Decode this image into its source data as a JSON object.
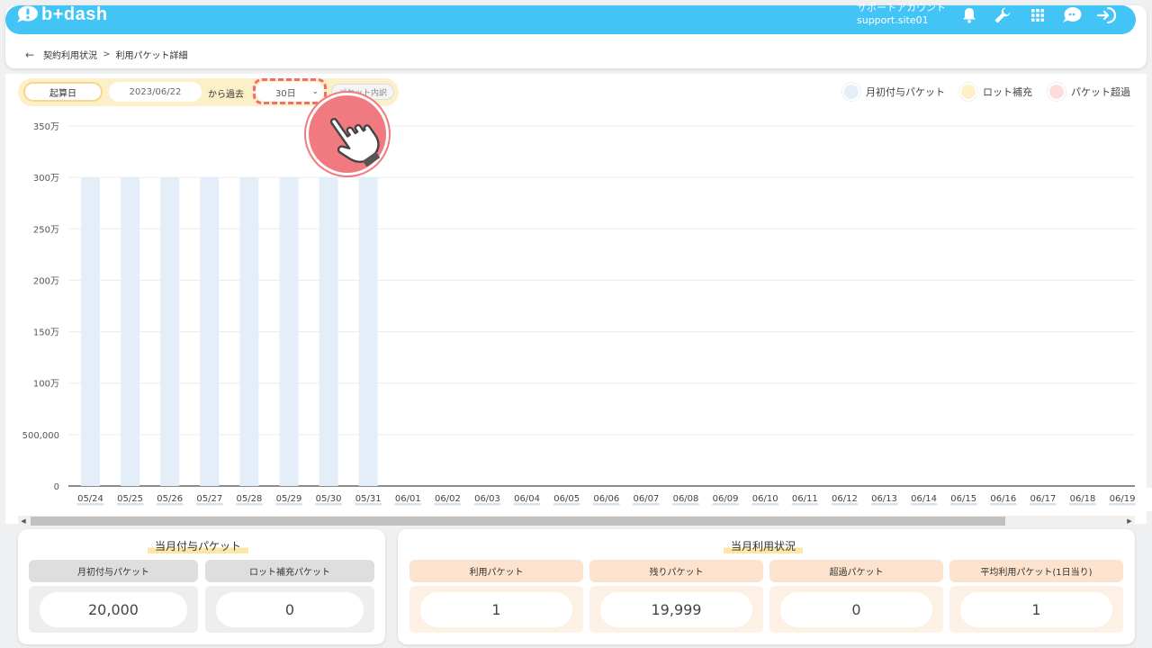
{
  "header": {
    "logo_text": "b+dash",
    "account_name": "サポートアカウント",
    "account_site": "support.site01",
    "icons": [
      "bell-icon",
      "wrench-icon",
      "grid-icon",
      "chat-icon",
      "logout-icon"
    ],
    "bg_color": "#42c4f7"
  },
  "breadcrumb": {
    "parent": "契約利用状況",
    "separator": ">",
    "current": "利用パケット詳細"
  },
  "filters": {
    "kisanbi_label": "起算日",
    "date_value": "2023/06/22",
    "from_past_label": "から過去",
    "range_value": "30日",
    "detail_button": "パケット内訳"
  },
  "legend": [
    {
      "label": "月初付与パケット",
      "color": "#e3eef9"
    },
    {
      "label": "ロット補充",
      "color": "#fcf0c8"
    },
    {
      "label": "パケット超過",
      "color": "#fddcdc"
    }
  ],
  "chart_data": {
    "type": "bar",
    "y_tick_labels": [
      "0",
      "500,000",
      "100万",
      "150万",
      "200万",
      "250万",
      "300万",
      "350万"
    ],
    "ylim": [
      0,
      3500000
    ],
    "grid": true,
    "categories": [
      "05/24",
      "05/25",
      "05/26",
      "05/27",
      "05/28",
      "05/29",
      "05/30",
      "05/31",
      "06/01",
      "06/02",
      "06/03",
      "06/04",
      "06/05",
      "06/06",
      "06/07",
      "06/08",
      "06/09",
      "06/10",
      "06/11",
      "06/12",
      "06/13",
      "06/14",
      "06/15",
      "06/16",
      "06/17",
      "06/18",
      "06/19"
    ],
    "values": [
      3000000,
      3000000,
      3000000,
      3000000,
      3000000,
      3000000,
      3000000,
      3000000,
      0,
      0,
      0,
      0,
      0,
      0,
      0,
      0,
      0,
      0,
      0,
      0,
      0,
      0,
      0,
      0,
      0,
      0,
      0
    ],
    "bar_color": "#e3eef9"
  },
  "summary_left": {
    "title": "当月付与パケット",
    "columns": [
      {
        "label": "月初付与パケット",
        "value": "20,000"
      },
      {
        "label": "ロット補充パケット",
        "value": "0"
      }
    ]
  },
  "summary_right": {
    "title": "当月利用状況",
    "columns": [
      {
        "label": "利用パケット",
        "value": "1"
      },
      {
        "label": "残りパケット",
        "value": "19,999"
      },
      {
        "label": "超過パケット",
        "value": "0"
      },
      {
        "label": "平均利用パケット(1日当り)",
        "value": "1"
      }
    ]
  }
}
